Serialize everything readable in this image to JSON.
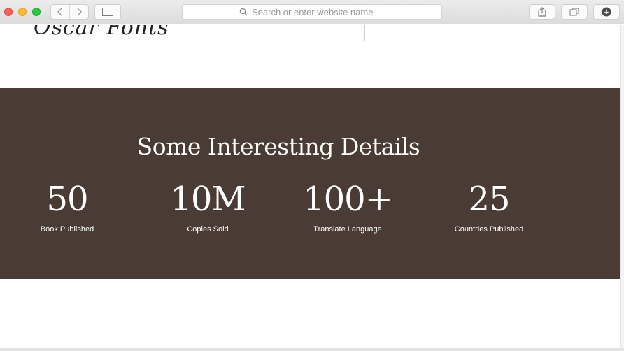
{
  "browser": {
    "address_placeholder": "Search or enter website name"
  },
  "page": {
    "logo_text": "Oscar Fonts"
  },
  "stats": {
    "title": "Some Interesting Details",
    "items": [
      {
        "value": "50",
        "label": "Book Published"
      },
      {
        "value": "10M",
        "label": "Copies Sold"
      },
      {
        "value": "100+",
        "label": "Translate Language"
      },
      {
        "value": "25",
        "label": "Countries Published"
      }
    ]
  },
  "colors": {
    "section_bg": "#4a3c35",
    "text": "#ffffff"
  }
}
